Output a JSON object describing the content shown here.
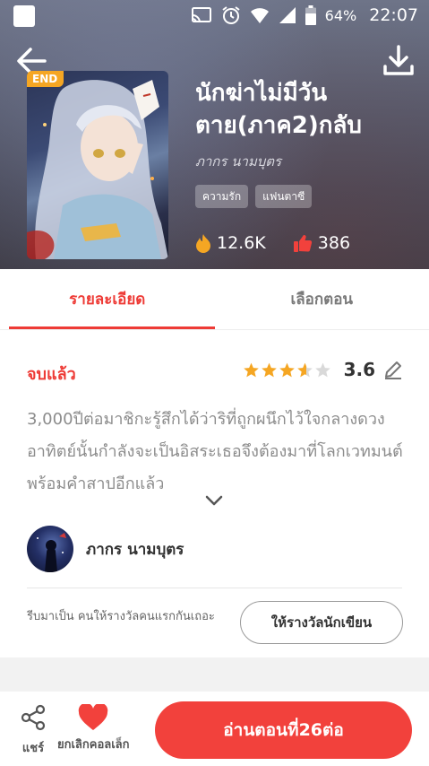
{
  "status_bar": {
    "battery": "64%",
    "time": "22:07"
  },
  "header": {
    "badge": "END",
    "title": "นักฆ่าไม่มีวันตาย(ภาค2)กลับ",
    "author": "ภากร นามบุตร",
    "tags": [
      "ความรัก",
      "แฟนตาซี"
    ],
    "views": "12.6K",
    "likes": "386"
  },
  "tabs": [
    {
      "label": "รายละเอียด",
      "active": true
    },
    {
      "label": "เลือกตอน",
      "active": false
    }
  ],
  "detail": {
    "status": "จบแล้ว",
    "rating": 3.6,
    "rating_text": "3.6",
    "synopsis": "3,000ปีต่อมาชิกะรู้สึกได้ว่าริที่ถูกผนึกไว้ใจกลางดวงอาทิตย์นั้นกำลังจะเป็นอิสระเธอจึงต้องมาที่โลกเวทมนต์พร้อมคำสาปอีกแล้ว",
    "author_name": "ภากร นามบุตร",
    "reward_prompt": "รีบมาเป็น คนให้รางวัลคนแรกกันเถอะ",
    "reward_button": "ให้รางวัลนักเขียน"
  },
  "bottom_bar": {
    "share_label": "แชร์",
    "uncollect_label": "ยกเลิกคอลเล็ก",
    "read_button": "อ่านตอนที่26ต่อ"
  },
  "colors": {
    "accent": "#ee3b36",
    "star": "#f5a623",
    "fire": "#f5a623",
    "heart": "#f2413c"
  },
  "icons": [
    "back-arrow-icon",
    "download-icon",
    "fire-icon",
    "thumbs-up-icon",
    "star-icon",
    "edit-pencil-icon",
    "chevron-down-icon",
    "share-icon",
    "heart-icon"
  ]
}
